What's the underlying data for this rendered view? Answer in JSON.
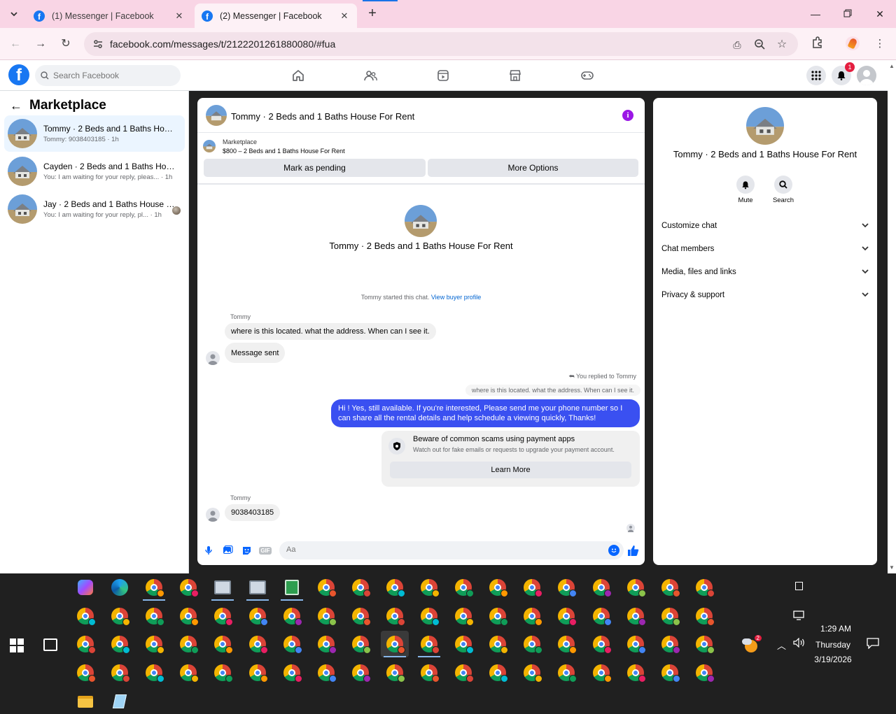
{
  "browser": {
    "tabs": [
      {
        "title": "(1) Messenger | Facebook",
        "active": false
      },
      {
        "title": "(2) Messenger | Facebook",
        "active": true
      }
    ],
    "url": "facebook.com/messages/t/2122201261880080/#fua"
  },
  "fb": {
    "search_placeholder": "Search Facebook",
    "notification_count": "1",
    "brand_color": "#1877f2"
  },
  "sidebar": {
    "title": "Marketplace",
    "conversations": [
      {
        "name": "Tommy · 2 Beds and 1 Baths House...",
        "preview": "Tommy: 9038403185 · 1h",
        "selected": true
      },
      {
        "name": "Cayden · 2 Beds and 1 Baths Hous...",
        "preview": "You: I am waiting for your reply, pleas... · 1h",
        "selected": false
      },
      {
        "name": "Jay · 2 Beds and 1 Baths House F...",
        "preview": "You: I am waiting for your reply, pl... · 1h",
        "selected": false
      }
    ]
  },
  "chat": {
    "header_name": "Tommy · 2 Beds and 1 Baths House For Rent",
    "listing_label": "Marketplace",
    "listing_detail": "$800 – 2 Beds and 1 Baths House For Rent",
    "mark_pending": "Mark as pending",
    "more_options": "More Options",
    "center_name": "Tommy · 2 Beds and 1 Baths House For Rent",
    "system_text": "Tommy started this chat.",
    "system_link": "View buyer profile",
    "messages": [
      {
        "sender": "Tommy",
        "text": "where is this located. what the address. When can I see it."
      },
      {
        "text": "Message sent"
      }
    ],
    "reply_note": "You replied to Tommy",
    "quoted_text": "where is this located. what the address. When can I see it.",
    "my_message": "Hi ! Yes, still available. If you're interested, Please send me your phone number so I can share all the rental details and help schedule a viewing quickly, Thanks!",
    "my_bubble_color": "#3a50f1",
    "warning_title": "Beware of common scams using payment apps",
    "warning_sub": "Watch out for fake emails or requests to upgrade your payment account.",
    "learn_more": "Learn More",
    "last_sender": "Tommy",
    "last_message": "9038403185",
    "composer_placeholder": "Aa"
  },
  "info": {
    "name": "Tommy · 2 Beds and 1 Baths House For Rent",
    "mute_label": "Mute",
    "search_label": "Search",
    "sections": [
      "Customize chat",
      "Chat members",
      "Media, files and links",
      "Privacy & support"
    ]
  },
  "taskbar": {
    "time": "1:29 AM",
    "day": "Thursday",
    "date": "3/19/2026",
    "weather_badge": "2"
  }
}
